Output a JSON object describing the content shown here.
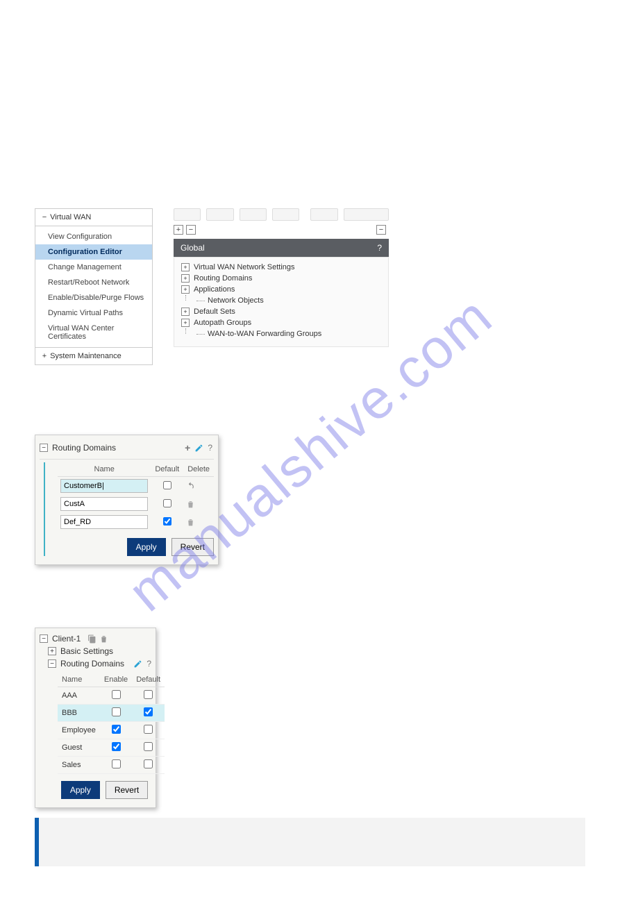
{
  "watermark": "manualshive.com",
  "sidenav": {
    "header_sign": "−",
    "header": "Virtual WAN",
    "items": [
      "View Configuration",
      "Configuration Editor",
      "Change Management",
      "Restart/Reboot Network",
      "Enable/Disable/Purge Flows",
      "Dynamic Virtual Paths",
      "Virtual WAN Center Certificates"
    ],
    "active_index": 1,
    "footer_sign": "+",
    "footer": "System Maintenance"
  },
  "config_panel": {
    "header": "Global",
    "help": "?",
    "expand_all": "+",
    "collapse_all": "−",
    "collapse_right": "−",
    "tree": [
      {
        "sign": "+",
        "label": "Virtual WAN Network Settings",
        "indent": 0
      },
      {
        "sign": "+",
        "label": "Routing Domains",
        "indent": 0
      },
      {
        "sign": "+",
        "label": "Applications",
        "indent": 0
      },
      {
        "sign": "",
        "label": "Network Objects",
        "indent": 1
      },
      {
        "sign": "+",
        "label": "Default Sets",
        "indent": 0
      },
      {
        "sign": "+",
        "label": "Autopath Groups",
        "indent": 0
      },
      {
        "sign": "",
        "label": "WAN-to-WAN Forwarding Groups",
        "indent": 1
      }
    ]
  },
  "rd_editor": {
    "sign": "−",
    "title": "Routing Domains",
    "add_label": "+",
    "help": "?",
    "cols": {
      "name": "Name",
      "default": "Default",
      "delete": "Delete"
    },
    "rows": [
      {
        "name": "CustomerB|",
        "default_checked": false,
        "delete_icon": "revert",
        "hl": true
      },
      {
        "name": "CustA",
        "default_checked": false,
        "delete_icon": "trash",
        "hl": false
      },
      {
        "name": "Def_RD",
        "default_checked": true,
        "delete_icon": "trash",
        "hl": false
      }
    ],
    "apply": "Apply",
    "revert": "Revert"
  },
  "client_card": {
    "sign": "−",
    "title": "Client-1",
    "basic_sign": "+",
    "basic": "Basic Settings",
    "rd_sign": "−",
    "rd_title": "Routing Domains",
    "help": "?",
    "cols": {
      "name": "Name",
      "enable": "Enable",
      "default": "Default"
    },
    "rows": [
      {
        "name": "AAA",
        "enable": false,
        "default": false,
        "hl": false
      },
      {
        "name": "BBB",
        "enable": false,
        "default": true,
        "hl": true
      },
      {
        "name": "Employee",
        "enable": true,
        "default": false,
        "hl": false
      },
      {
        "name": "Guest",
        "enable": true,
        "default": false,
        "hl": false
      },
      {
        "name": "Sales",
        "enable": false,
        "default": false,
        "hl": false
      }
    ],
    "apply": "Apply",
    "revert": "Revert"
  }
}
